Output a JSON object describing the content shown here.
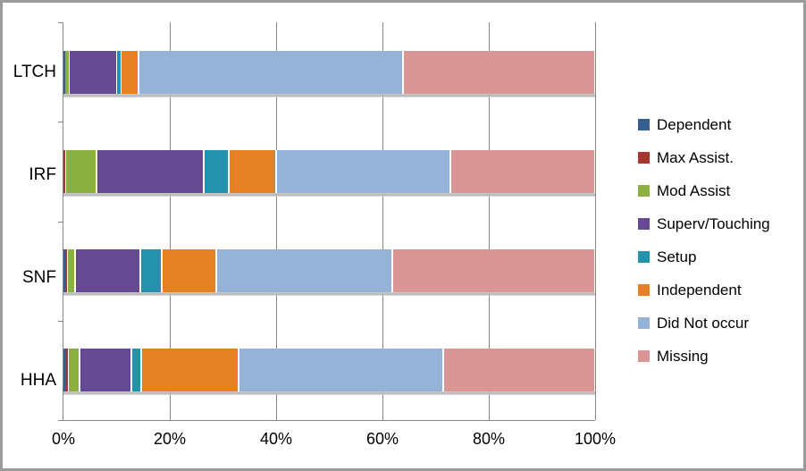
{
  "chart_data": {
    "type": "bar",
    "subtype": "stacked-bar-100-percent-horizontal",
    "title": "",
    "xlabel": "",
    "ylabel": "",
    "xlim": [
      0,
      100
    ],
    "xticks": [
      0,
      20,
      40,
      60,
      80,
      100
    ],
    "xtick_labels": [
      "0%",
      "20%",
      "40%",
      "60%",
      "80%",
      "100%"
    ],
    "grid": true,
    "legend_position": "right",
    "categories": [
      "LTCH",
      "IRF",
      "SNF",
      "HHA"
    ],
    "category_order_top_to_bottom": [
      "LTCH",
      "IRF",
      "SNF",
      "HHA"
    ],
    "series": [
      {
        "name": "Dependent",
        "color": "#376092",
        "values": [
          0.3,
          0.0,
          0.3,
          0.4
        ]
      },
      {
        "name": "Max Assist.",
        "color": "#a63530",
        "values": [
          0.0,
          0.4,
          0.3,
          0.4
        ]
      },
      {
        "name": "Mod Assist",
        "color": "#8cb03f",
        "values": [
          0.7,
          5.8,
          1.6,
          2.2
        ]
      },
      {
        "name": "Superv/Touching",
        "color": "#654a93",
        "values": [
          9.1,
          20.2,
          12.2,
          9.7
        ]
      },
      {
        "name": "Setup",
        "color": "#2492ab",
        "values": [
          0.7,
          4.7,
          4.1,
          1.9
        ]
      },
      {
        "name": "Independent",
        "color": "#e58024",
        "values": [
          3.4,
          8.9,
          10.3,
          18.3
        ]
      },
      {
        "name": "Did Not occur",
        "color": "#95b3d7",
        "values": [
          49.7,
          32.8,
          33.1,
          38.5
        ]
      },
      {
        "name": "Missing",
        "color": "#d99694",
        "values": [
          36.1,
          27.2,
          38.1,
          28.6
        ]
      }
    ]
  },
  "legend": {
    "items": [
      {
        "label": "Dependent"
      },
      {
        "label": "Max Assist."
      },
      {
        "label": "Mod Assist"
      },
      {
        "label": "Superv/Touching"
      },
      {
        "label": "Setup"
      },
      {
        "label": "Independent"
      },
      {
        "label": "Did Not occur"
      },
      {
        "label": "Missing"
      }
    ]
  },
  "colors": {
    "axis": "#868686",
    "gridline": "#868686",
    "border": "#9b9b9b",
    "background": "#ffffff",
    "text": "#000000"
  }
}
